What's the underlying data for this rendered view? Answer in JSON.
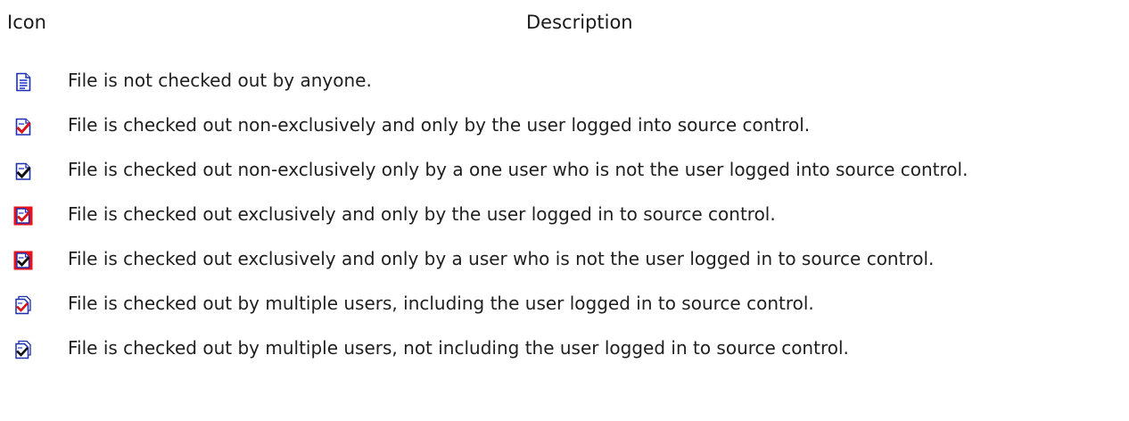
{
  "table": {
    "header": {
      "icon": "Icon",
      "description": "Description"
    },
    "rows": [
      {
        "icon": "file-not-checked-out-icon",
        "description": "File is not checked out by anyone."
      },
      {
        "icon": "file-checked-out-nonexclusive-self-icon",
        "description": "File is checked out non-exclusively and only by the user logged into source control."
      },
      {
        "icon": "file-checked-out-nonexclusive-other-icon",
        "description": "File is checked out non-exclusively only by a one user who is not the user logged into source control."
      },
      {
        "icon": "file-checked-out-exclusive-self-icon",
        "description": "File is checked out exclusively and only by the user logged in to source control."
      },
      {
        "icon": "file-checked-out-exclusive-other-icon",
        "description": "File is checked out exclusively and only by a user who is not the user logged in to source control."
      },
      {
        "icon": "file-checked-out-multiple-including-self-icon",
        "description": "File is checked out by multiple users, including the user logged in to source control."
      },
      {
        "icon": "file-checked-out-multiple-excluding-self-icon",
        "description": "File is checked out by multiple users, not including the user logged in to source control."
      }
    ]
  },
  "colors": {
    "doc_blue": "#2a3fd1",
    "check_red": "#d8141b",
    "exclusive_border": "#e8121a",
    "check_dark": "#111111"
  }
}
